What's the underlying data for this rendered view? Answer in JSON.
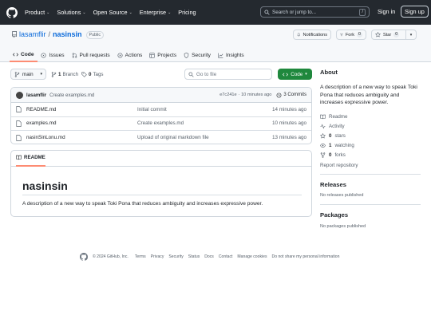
{
  "nav": {
    "items": [
      "Product",
      "Solutions",
      "Open Source",
      "Enterprise",
      "Pricing"
    ],
    "search_placeholder": "Search or jump to...",
    "search_shortcut": "/",
    "signin": "Sign in",
    "signup": "Sign up"
  },
  "repo": {
    "owner": "lasamflir",
    "separator": "/",
    "name": "nasinsin",
    "visibility": "Public",
    "notifications_label": "Notifications",
    "fork_label": "Fork",
    "fork_count": "0",
    "star_label": "Star",
    "star_count": "0"
  },
  "tabs": [
    "Code",
    "Issues",
    "Pull requests",
    "Actions",
    "Projects",
    "Security",
    "Insights"
  ],
  "toolbar": {
    "branch": "main",
    "branch_count": "1",
    "branch_label": "Branch",
    "tag_count": "0",
    "tag_label": "Tags",
    "goto_placeholder": "Go to file",
    "code_button": "Code"
  },
  "commit": {
    "author": "lasamflir",
    "message": "Create examples.md",
    "hash": "e7c241e",
    "time": "· 10 minutes ago",
    "commits": "3 Commits"
  },
  "files": [
    {
      "name": "README.md",
      "message": "Initial commit",
      "date": "14 minutes ago"
    },
    {
      "name": "examples.md",
      "message": "Create examples.md",
      "date": "10 minutes ago"
    },
    {
      "name": "nasinSinLonu.md",
      "message": "Upload of original markdown file",
      "date": "13 minutes ago"
    }
  ],
  "readme": {
    "tab": "README",
    "heading": "nasinsin",
    "body": "A description of a new way to speak Toki Pona that reduces ambiguity and increases expressive power."
  },
  "about": {
    "title": "About",
    "description": "A description of a new way to speak Toki Pona that reduces ambiguity and increases expressive power.",
    "readme_link": "Readme",
    "activity_link": "Activity",
    "stars_count": "0",
    "stars_label": "stars",
    "watching_count": "1",
    "watching_label": "watching",
    "forks_count": "0",
    "forks_label": "forks",
    "report": "Report repository"
  },
  "releases": {
    "title": "Releases",
    "empty": "No releases published"
  },
  "packages": {
    "title": "Packages",
    "empty": "No packages published"
  },
  "footer": {
    "copyright": "© 2024 GitHub, Inc.",
    "links": [
      "Terms",
      "Privacy",
      "Security",
      "Status",
      "Docs",
      "Contact",
      "Manage cookies",
      "Do not share my personal information"
    ]
  },
  "colors": {
    "accent": "#0969da",
    "header_bg": "#24292f",
    "code_green": "#1f883d",
    "tab_underline": "#fd8c73"
  }
}
